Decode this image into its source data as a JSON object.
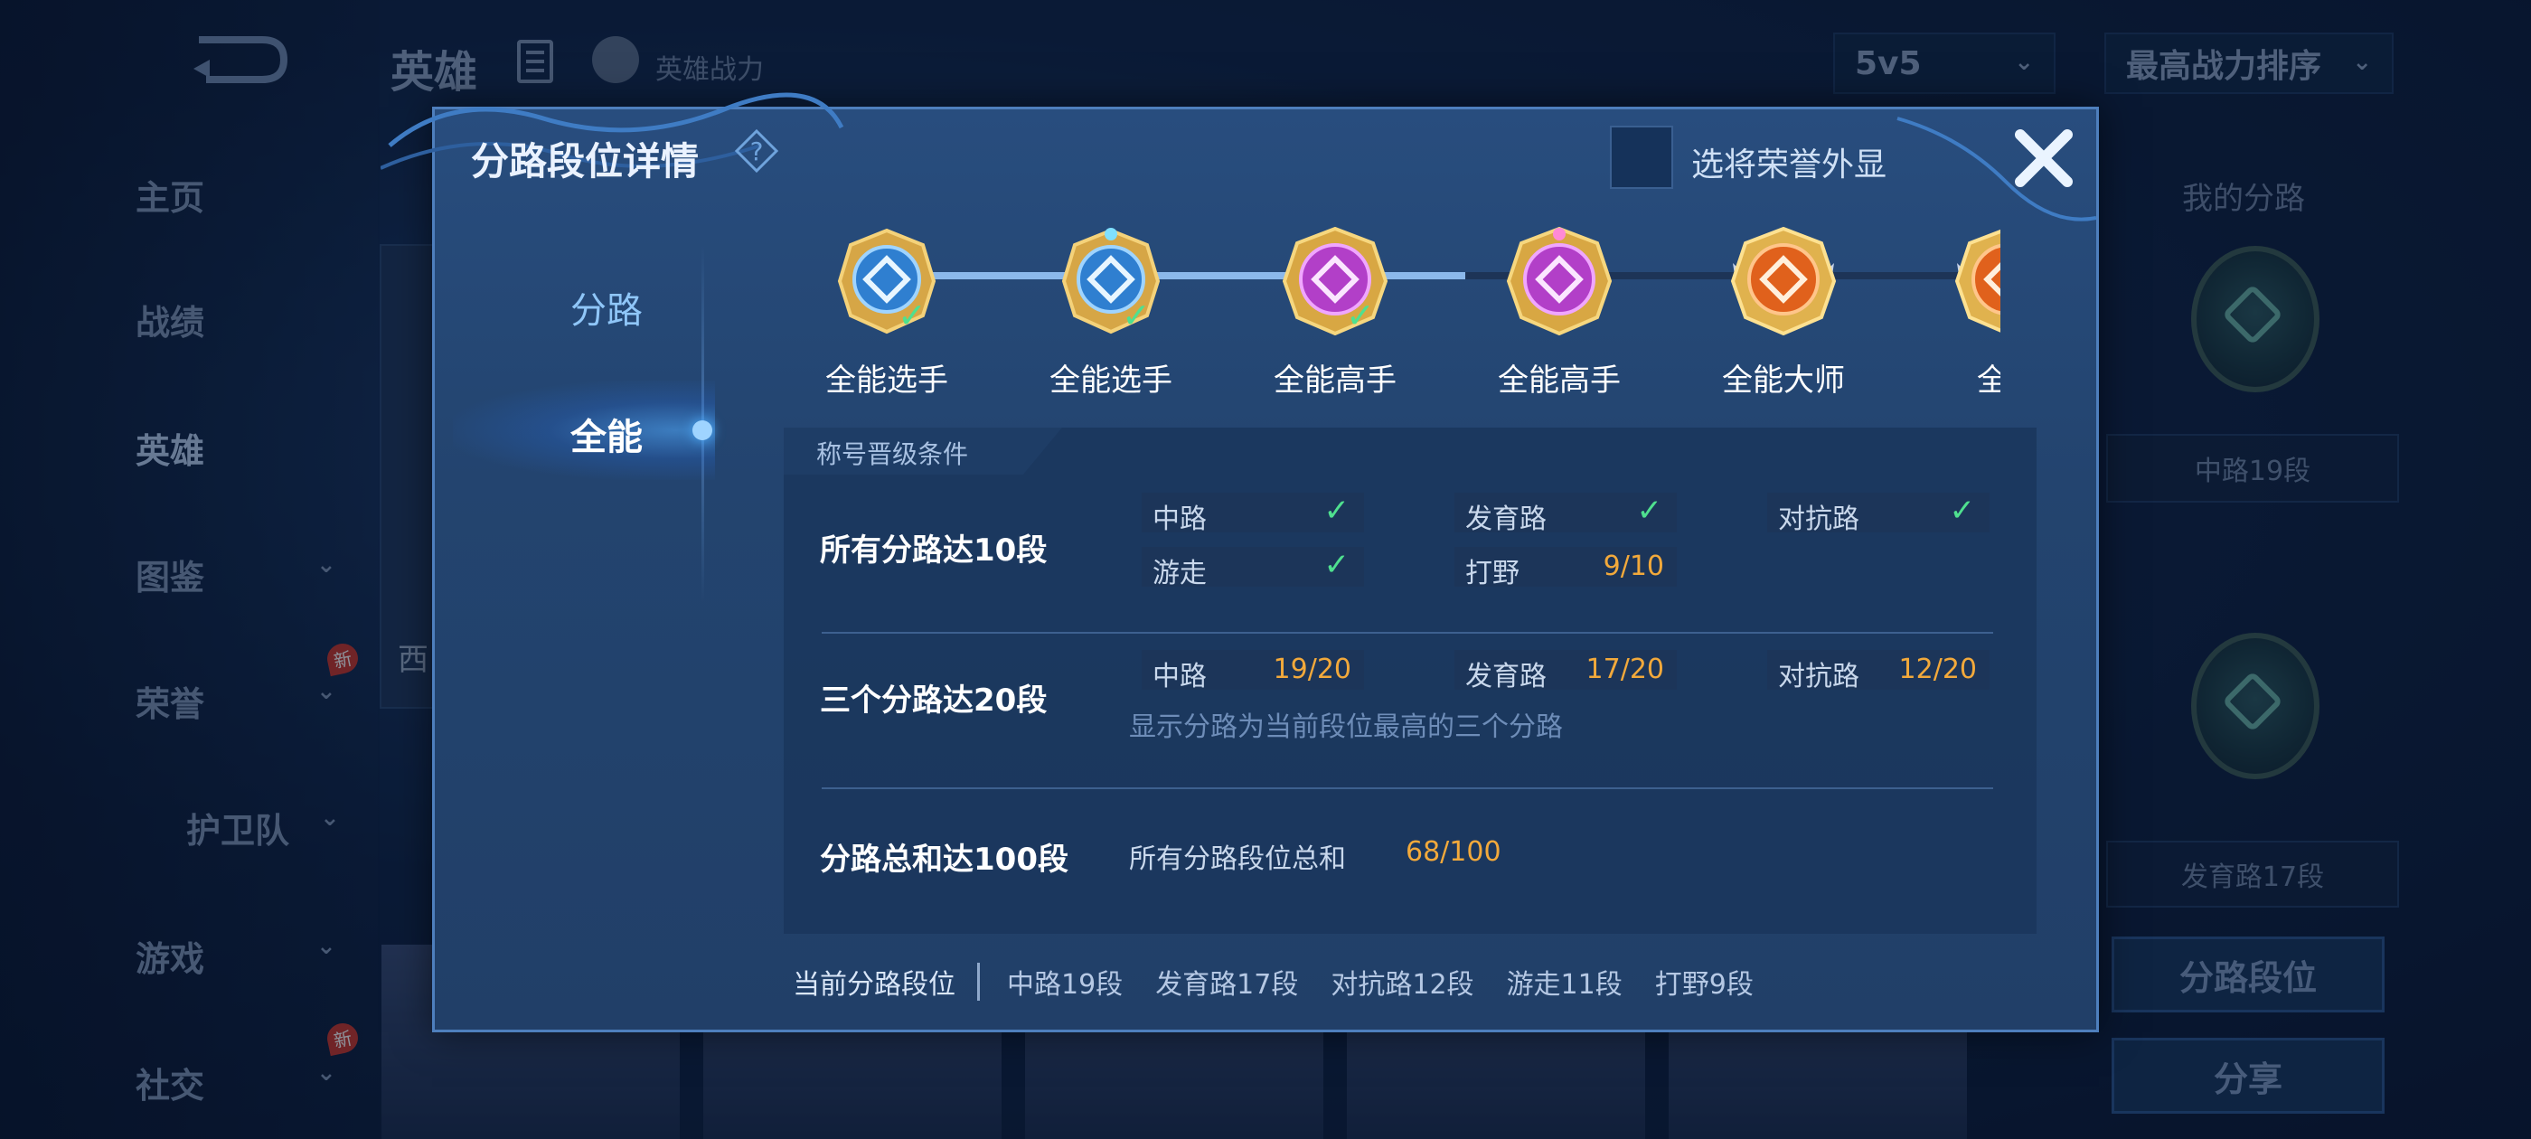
{
  "header": {
    "title": "英雄",
    "power_label": "英雄战力",
    "mode_select": "5v5",
    "sort_select": "最高战力排序"
  },
  "sidebar": {
    "items": [
      {
        "label": "主页"
      },
      {
        "label": "战绩"
      },
      {
        "label": "英雄"
      },
      {
        "label": "图鉴"
      },
      {
        "label": "荣誉",
        "badge": "新"
      },
      {
        "label": "护卫队"
      },
      {
        "label": "游戏"
      },
      {
        "label": "社交",
        "badge": "新"
      }
    ],
    "partial_card_text": "西"
  },
  "right_panel": {
    "title": "我的分路",
    "lane_1": "中路19段",
    "lane_2": "发育路17段",
    "lane_rank_button": "分路段位",
    "share_button": "分享"
  },
  "modal": {
    "title": "分路段位详情",
    "honor_display_label": "选将荣誉外显",
    "tabs": [
      "分路",
      "全能"
    ],
    "active_tab": "全能",
    "ranks": [
      {
        "label": "全能选手",
        "achieved": true,
        "color": "#2f7fd0"
      },
      {
        "label": "全能选手",
        "achieved": true,
        "color": "#2f7fd0"
      },
      {
        "label": "全能高手",
        "achieved": true,
        "color": "#b23fc8"
      },
      {
        "label": "全能高手",
        "achieved": false,
        "color": "#b23fc8"
      },
      {
        "label": "全能大师",
        "achieved": false,
        "color": "#e0611c"
      },
      {
        "label": "全能",
        "achieved": false,
        "color": "#e0611c"
      }
    ],
    "conditions_header": "称号晋级条件",
    "condition_1": {
      "title": "所有分路达10段",
      "cells": [
        {
          "name": "中路",
          "done": true
        },
        {
          "name": "发育路",
          "done": true
        },
        {
          "name": "对抗路",
          "done": true
        },
        {
          "name": "游走",
          "done": true
        },
        {
          "name": "打野",
          "progress": "9/10"
        }
      ]
    },
    "condition_2": {
      "title": "三个分路达20段",
      "cells": [
        {
          "name": "中路",
          "progress": "19/20"
        },
        {
          "name": "发育路",
          "progress": "17/20"
        },
        {
          "name": "对抗路",
          "progress": "12/20"
        }
      ],
      "note": "显示分路为当前段位最高的三个分路"
    },
    "condition_3": {
      "title": "分路总和达100段",
      "label": "所有分路段位总和",
      "progress": "68/100"
    },
    "footer": {
      "label": "当前分路段位",
      "items": [
        "中路19段",
        "发育路17段",
        "对抗路12段",
        "游走11段",
        "打野9段"
      ]
    }
  },
  "colors": {
    "accent_check": "#4fe08f",
    "progress_orange": "#f2a93b"
  }
}
